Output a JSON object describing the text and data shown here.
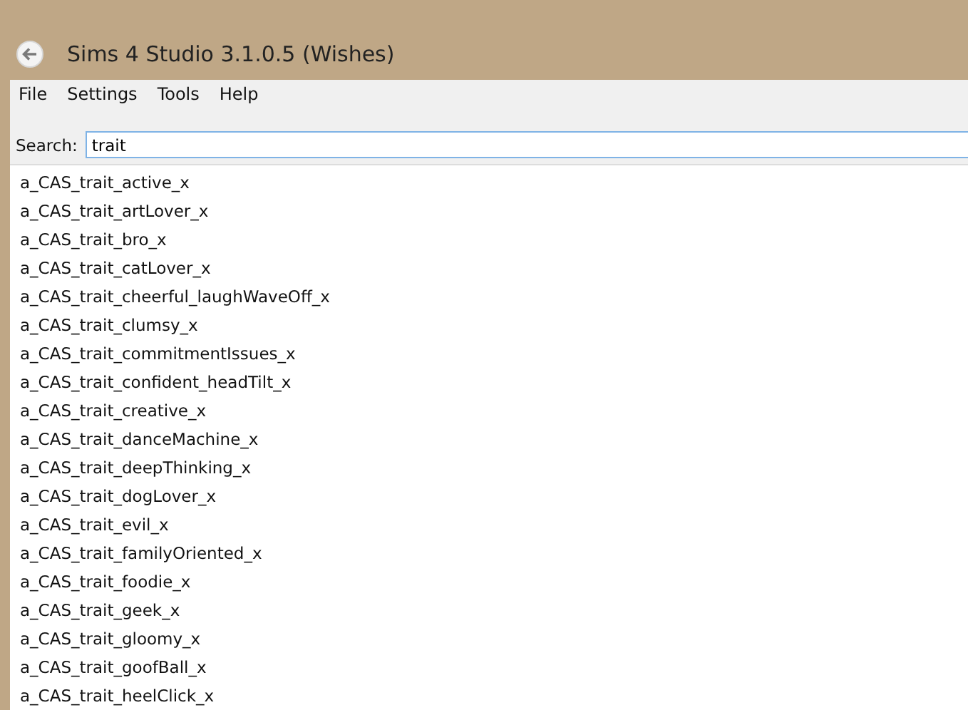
{
  "window": {
    "title": "Sims 4 Studio 3.1.0.5 (Wishes)"
  },
  "menu": [
    "File",
    "Settings",
    "Tools",
    "Help"
  ],
  "search": {
    "label": "Search:",
    "value": "trait"
  },
  "results": [
    "a_CAS_trait_active_x",
    "a_CAS_trait_artLover_x",
    "a_CAS_trait_bro_x",
    "a_CAS_trait_catLover_x",
    "a_CAS_trait_cheerful_laughWaveOff_x",
    "a_CAS_trait_clumsy_x",
    "a_CAS_trait_commitmentIssues_x",
    "a_CAS_trait_confident_headTilt_x",
    "a_CAS_trait_creative_x",
    "a_CAS_trait_danceMachine_x",
    "a_CAS_trait_deepThinking_x",
    "a_CAS_trait_dogLover_x",
    "a_CAS_trait_evil_x",
    "a_CAS_trait_familyOriented_x",
    "a_CAS_trait_foodie_x",
    "a_CAS_trait_geek_x",
    "a_CAS_trait_gloomy_x",
    "a_CAS_trait_goofBall_x",
    "a_CAS_trait_heelClick_x"
  ]
}
